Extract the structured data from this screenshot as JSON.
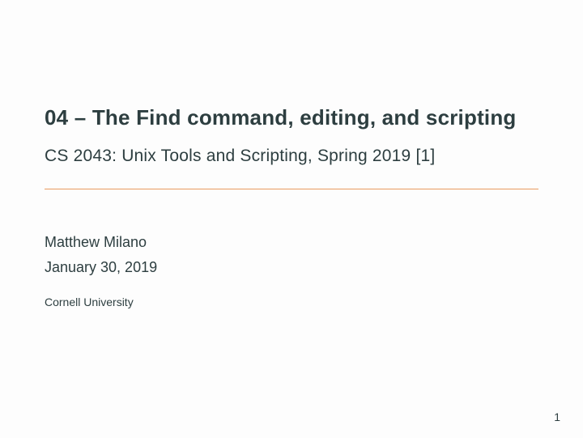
{
  "title": "04 – The Find command, editing, and scripting",
  "subtitle": "CS 2043: Unix Tools and Scripting, Spring 2019 [1]",
  "author": "Matthew Milano",
  "date": "January 30, 2019",
  "institution": "Cornell University",
  "page_number": "1"
}
